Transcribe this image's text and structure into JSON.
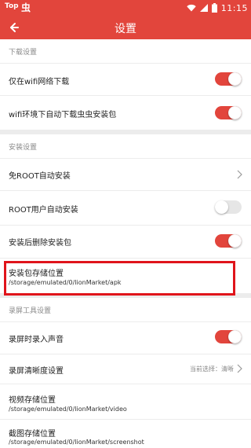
{
  "status_bar": {
    "left_text": "Top",
    "bug_glyph": "虫",
    "time": "11:15",
    "icons": [
      "wifi-icon",
      "signal-icon",
      "battery-icon"
    ]
  },
  "app_bar": {
    "title": "设置",
    "back_icon": "arrow-left-icon",
    "color": "#e2453c"
  },
  "sections": {
    "download": {
      "header": "下载设置",
      "items": [
        {
          "label": "仅在wifi网络下载",
          "toggle": true
        },
        {
          "label": "wifi环境下自动下载虫虫安装包",
          "toggle": true
        }
      ]
    },
    "install": {
      "header": "安装设置",
      "items": [
        {
          "label": "免ROOT自动安装",
          "chevron": true
        },
        {
          "label": "ROOT用户自动安装",
          "toggle": false
        },
        {
          "label": "安装后删除安装包",
          "toggle": true
        },
        {
          "label": "安装包存储位置",
          "sub": "/storage/emulated/0/lionMarket/apk"
        }
      ]
    },
    "recording": {
      "header": "录屏工具设置",
      "items": [
        {
          "label": "录屏时录入声音",
          "toggle": true
        },
        {
          "label": "录屏清晰度设置",
          "value": "当前选择：清晰",
          "chevron": true
        },
        {
          "label": "视频存储位置",
          "sub": "/storage/emulated/0/lionMarket/video"
        },
        {
          "label": "截图存储位置",
          "sub": "/storage/emulated/0/lionMarket/screenshot"
        }
      ]
    }
  },
  "colors": {
    "accent": "#e2453c",
    "highlight_border": "#e0141b",
    "toggle_off": "#e6e6e6",
    "section_text": "#8a8a8a"
  }
}
